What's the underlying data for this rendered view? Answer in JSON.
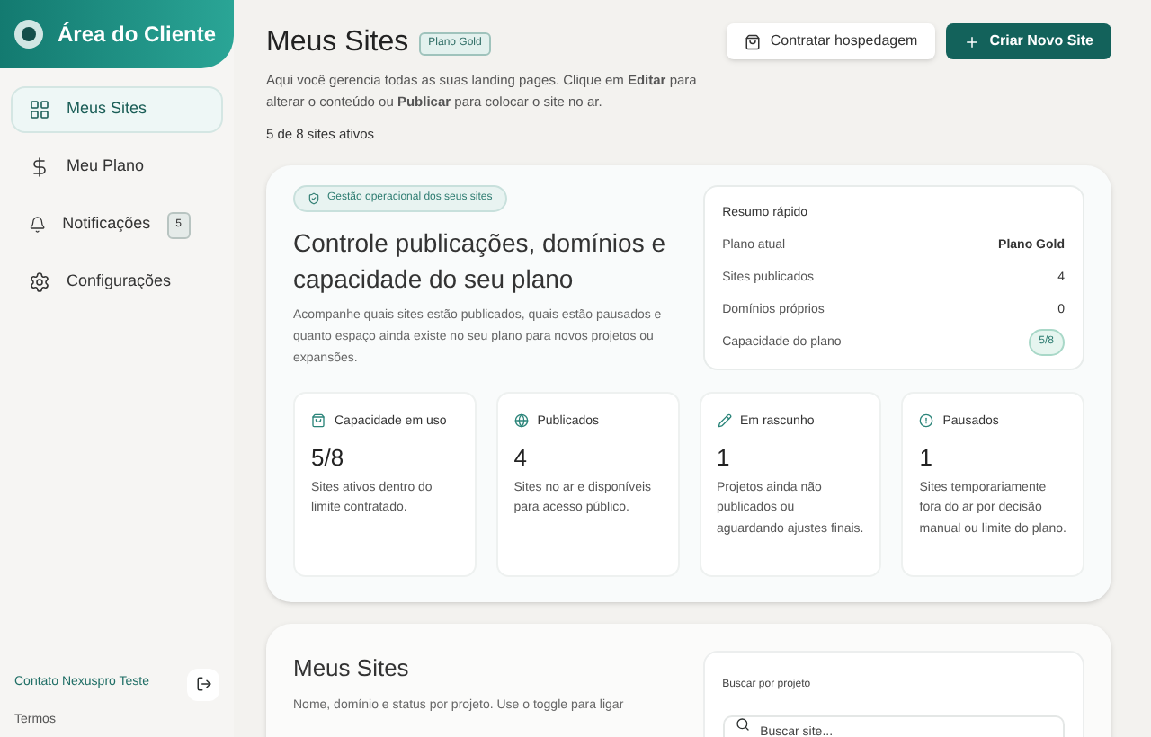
{
  "sidebar": {
    "brand": "Área do Cliente",
    "items": [
      {
        "kind": "grid",
        "label": "Meus Sites",
        "selected": true
      },
      {
        "kind": "dollar",
        "label": "Meu Plano",
        "selected": false
      },
      {
        "kind": "bell",
        "label": "Notificações",
        "selected": false,
        "badge": "5"
      },
      {
        "kind": "gear",
        "label": "Configurações",
        "selected": false
      }
    ],
    "contact": "Contato Nexuspro Teste",
    "terms": "Termos"
  },
  "header": {
    "title": "Meus Sites",
    "plan_badge": "Plano Gold",
    "description": "Aqui você gerencia todas as suas landing pages. Clique em **Editar** para alterar o conteúdo ou **Publicar** para colocar o site no ar.",
    "active_count": "5 de 8 sites ativos",
    "secondary_button": "Contratar hospedagem",
    "primary_button": "Criar Novo Site"
  },
  "overview": {
    "tag": "Gestão operacional dos seus sites",
    "heading": "Controle publicações, domínios e capacidade do seu plano",
    "text": "Acompanhe quais sites estão publicados, quais estão pausados e quanto espaço ainda existe no seu plano para novos projetos ou expansões.",
    "summary": {
      "title": "Resumo rápido",
      "rows": [
        {
          "label": "Plano atual",
          "value": "Plano Gold",
          "kind": "strong"
        },
        {
          "label": "Sites publicados",
          "value": "4",
          "kind": "plain"
        },
        {
          "label": "Domínios próprios",
          "value": "0",
          "kind": "plain"
        },
        {
          "label": "Capacidade do plano",
          "value": "5/8",
          "kind": "pill"
        }
      ]
    },
    "stats": [
      {
        "kind": "bag",
        "title": "Capacidade em uso",
        "value": "5/8",
        "text": "Sites ativos dentro do limite contratado."
      },
      {
        "kind": "globe",
        "title": "Publicados",
        "value": "4",
        "text": "Sites no ar e disponíveis para acesso público."
      },
      {
        "kind": "pencil",
        "title": "Em rascunho",
        "value": "1",
        "text": "Projetos ainda não publicados ou aguardando ajustes finais."
      },
      {
        "kind": "alert",
        "title": "Pausados",
        "value": "1",
        "text": "Sites temporariamente fora do ar por decisão manual ou limite do plano."
      }
    ]
  },
  "sites": {
    "title": "Meus Sites",
    "text": "Nome, domínio e status por projeto. Use o toggle para ligar",
    "search_label": "Buscar por projeto",
    "search_placeholder": "Buscar site..."
  }
}
